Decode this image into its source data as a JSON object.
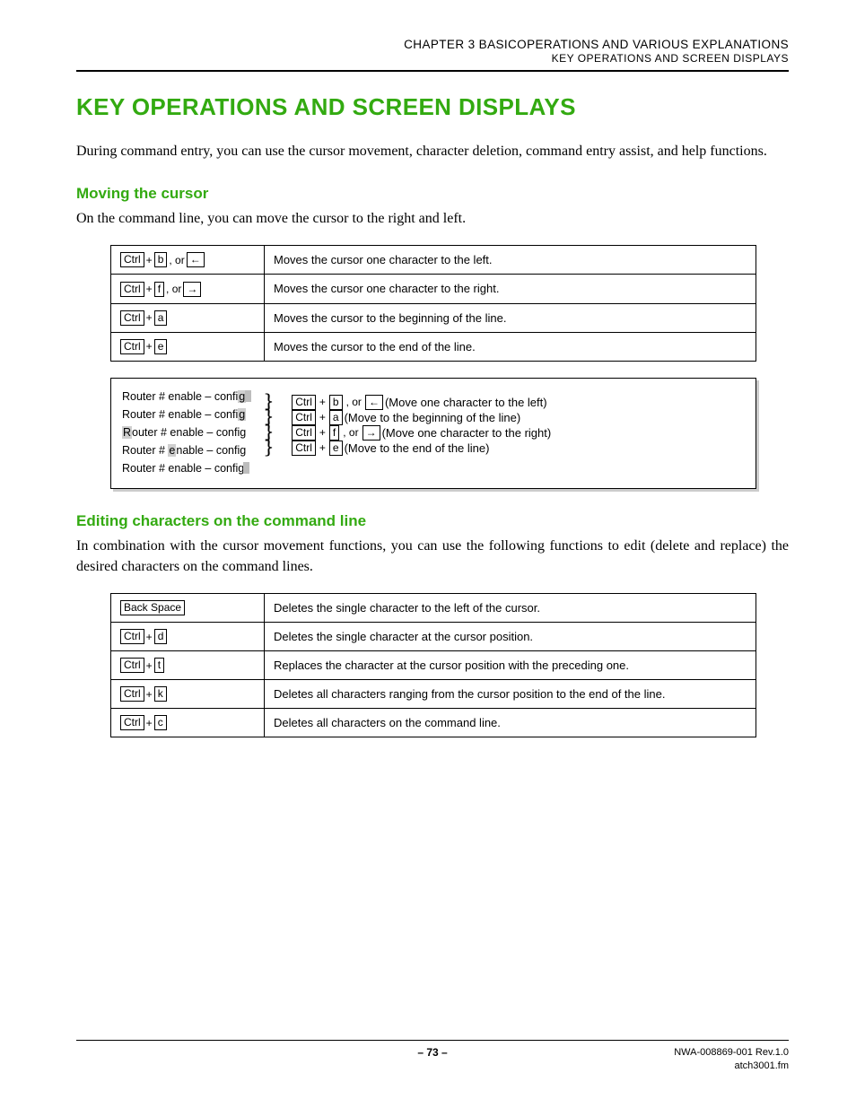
{
  "header": {
    "chapter": "CHAPTER 3   BASICOPERATIONS AND VARIOUS EXPLANATIONS",
    "section": "KEY OPERATIONS AND SCREEN DISPLAYS"
  },
  "title": "KEY OPERATIONS AND SCREEN DISPLAYS",
  "intro": "During command entry, you can use the cursor movement, character deletion, command entry assist, and help functions.",
  "s1": {
    "heading": "Moving the cursor",
    "lead": "On the command line, you can move the cursor to the right and left.",
    "rows": [
      {
        "keys": [
          [
            "Ctrl",
            "b"
          ],
          "arrow-left"
        ],
        "desc": "Moves the cursor one character to the left."
      },
      {
        "keys": [
          [
            "Ctrl",
            "f"
          ],
          "arrow-right"
        ],
        "desc": "Moves the cursor one character to the right."
      },
      {
        "keys": [
          [
            "Ctrl",
            "a"
          ]
        ],
        "desc": "Moves the cursor to the beginning of the line."
      },
      {
        "keys": [
          [
            "Ctrl",
            "e"
          ]
        ],
        "desc": "Moves the cursor to the end of the line."
      }
    ],
    "example": {
      "prompt": "Router # enable – config",
      "lines": [
        {
          "keys": [
            "Ctrl",
            "b"
          ],
          "arrow": "arrow-left",
          "text": "(Move one character to the left)"
        },
        {
          "keys": [
            "Ctrl",
            "a"
          ],
          "arrow": null,
          "text": "(Move to the beginning of the line)"
        },
        {
          "keys": [
            "Ctrl",
            "f"
          ],
          "arrow": "arrow-right",
          "text": "(Move one character to the right)"
        },
        {
          "keys": [
            "Ctrl",
            "e"
          ],
          "arrow": null,
          "text": "(Move to the end of the line)"
        }
      ]
    }
  },
  "s2": {
    "heading": "Editing characters on the command line",
    "lead": "In combination with the cursor movement functions, you can use the following functions to edit (delete and replace) the desired characters on the command lines.",
    "rows": [
      {
        "single": "Back Space",
        "desc": "Deletes the single character to the left of the cursor."
      },
      {
        "keys": [
          [
            "Ctrl",
            "d"
          ]
        ],
        "desc": "Deletes the single character at the cursor position."
      },
      {
        "keys": [
          [
            "Ctrl",
            "t"
          ]
        ],
        "desc": "Replaces the character at the cursor position with the preceding one."
      },
      {
        "keys": [
          [
            "Ctrl",
            "k"
          ]
        ],
        "desc": "Deletes all characters ranging from the cursor position to the end of the line."
      },
      {
        "keys": [
          [
            "Ctrl",
            "c"
          ]
        ],
        "desc": "Deletes all characters on the command line."
      }
    ]
  },
  "footer": {
    "page": "– 73 –",
    "docnum": "NWA-008869-001 Rev.1.0",
    "file": "atch3001.fm"
  },
  "labels": {
    "or": ", or "
  }
}
